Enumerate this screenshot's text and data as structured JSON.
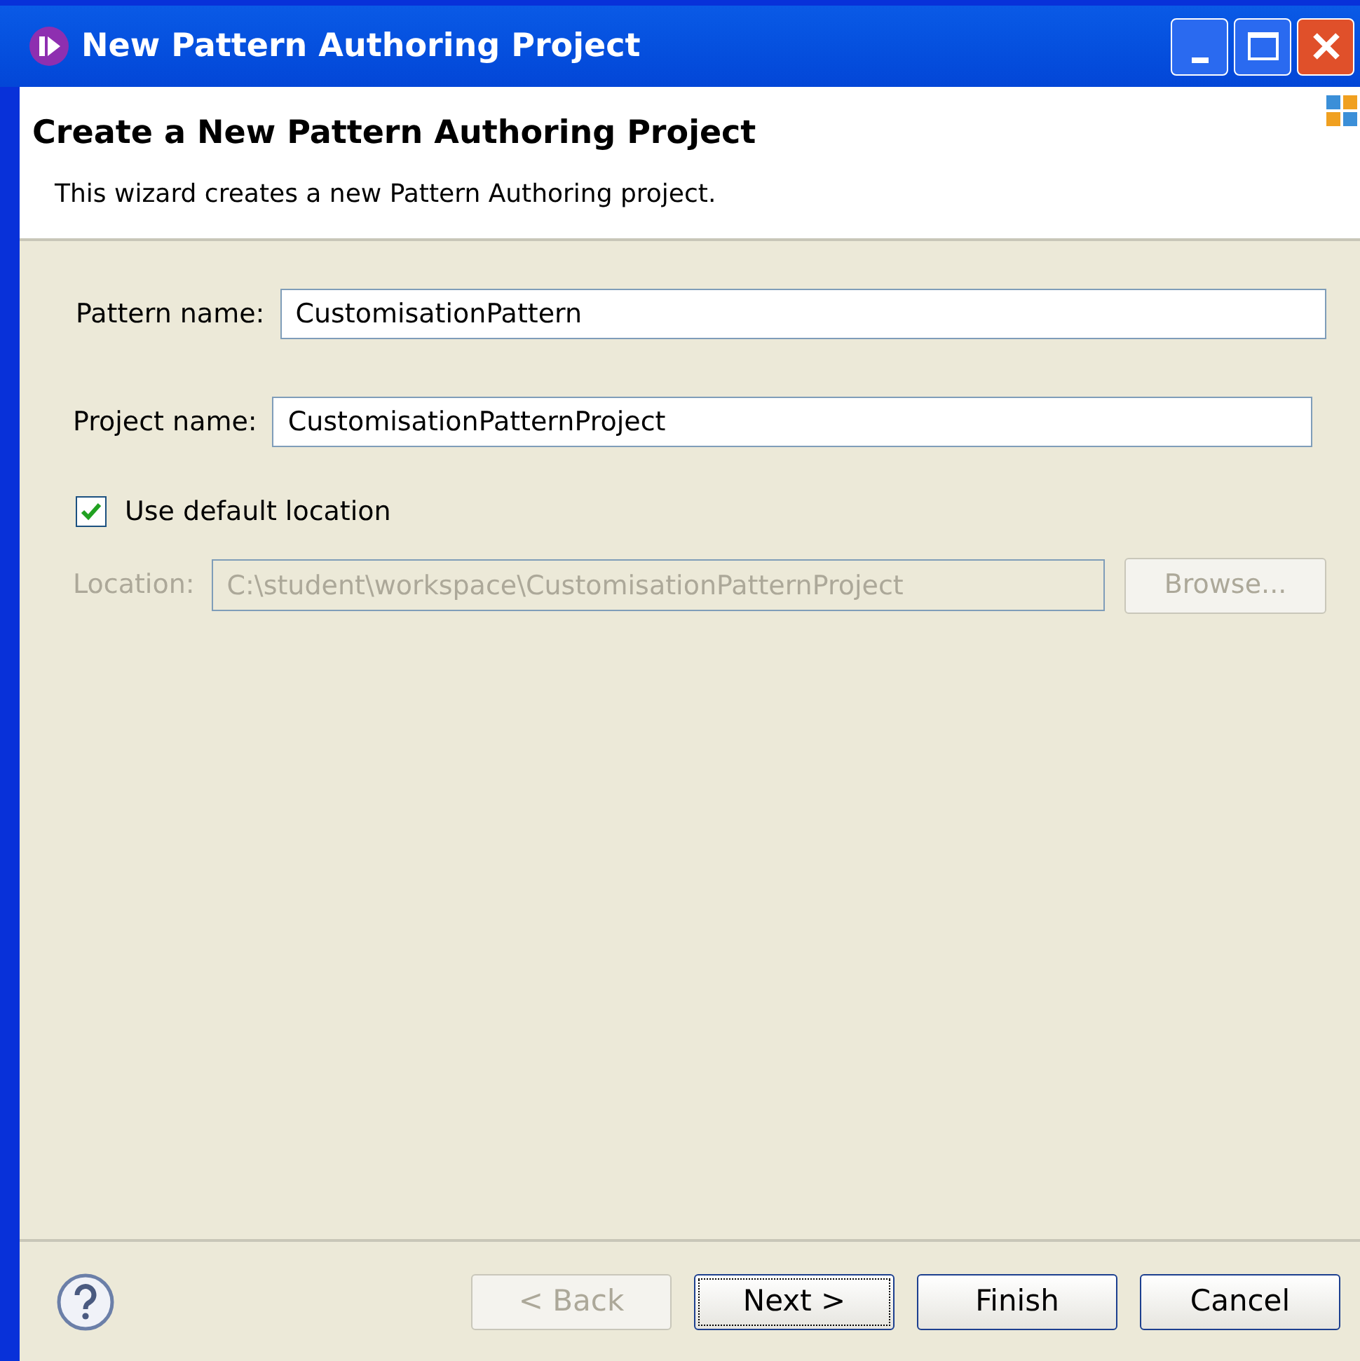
{
  "window": {
    "title": "New Pattern Authoring Project"
  },
  "header": {
    "title": "Create a New Pattern Authoring Project",
    "description": "This wizard creates a new Pattern Authoring project."
  },
  "fields": [
    {
      "label": "Pattern name:",
      "value": "CustomisationPattern",
      "disabled": false
    },
    {
      "label": "Project name:",
      "value": "CustomisationPatternProject",
      "disabled": false
    }
  ],
  "default_location": {
    "label": "Use default location",
    "checked": true
  },
  "location": {
    "label": "Location:",
    "value": "C:\\student\\workspace\\CustomisationPatternProject",
    "disabled": true,
    "browse": "Browse..."
  },
  "buttons": [
    {
      "label": "< Back",
      "disabled": true,
      "focused": false
    },
    {
      "label": "Next >",
      "disabled": false,
      "focused": true
    },
    {
      "label": "Finish",
      "disabled": false,
      "focused": false
    },
    {
      "label": "Cancel",
      "disabled": false,
      "focused": false
    }
  ]
}
